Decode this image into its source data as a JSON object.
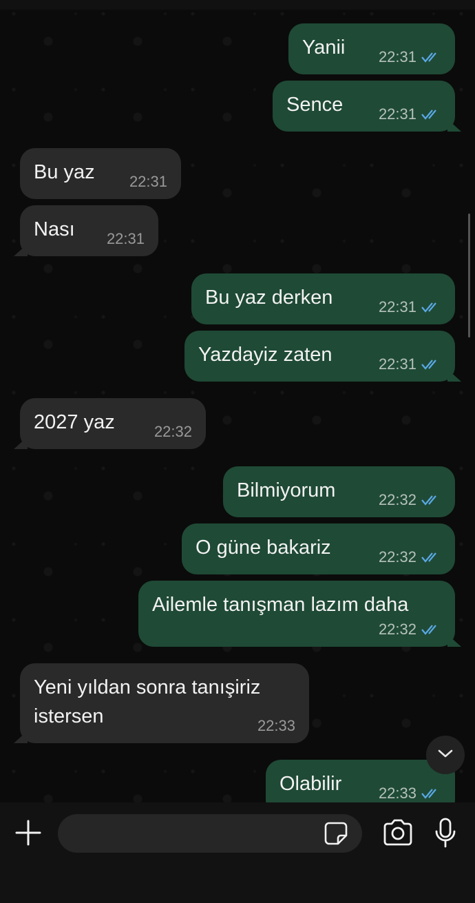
{
  "messages": [
    {
      "dir": "out",
      "text": "Yanii",
      "time": "22:31"
    },
    {
      "dir": "out",
      "text": "Sence",
      "time": "22:31"
    },
    {
      "dir": "in",
      "text": "Bu yaz",
      "time": "22:31"
    },
    {
      "dir": "in",
      "text": "Nası",
      "time": "22:31"
    },
    {
      "dir": "out",
      "text": "Bu yaz derken",
      "time": "22:31"
    },
    {
      "dir": "out",
      "text": "Yazdayiz zaten",
      "time": "22:31"
    },
    {
      "dir": "in",
      "text": "2027 yaz",
      "time": "22:32"
    },
    {
      "dir": "out",
      "text": "Bilmiyorum",
      "time": "22:32"
    },
    {
      "dir": "out",
      "text": "O güne bakariz",
      "time": "22:32"
    },
    {
      "dir": "out",
      "text": "Ailemle tanışman lazım daha",
      "time": "22:32"
    },
    {
      "dir": "in",
      "text": "Yeni yıldan sonra tanışiriz",
      "text2": "istersen",
      "time": "22:33"
    },
    {
      "dir": "out",
      "text": "Olabilir",
      "time": "22:33"
    }
  ],
  "input": {
    "placeholder": ""
  },
  "icons": [
    "plus-icon",
    "sticker-icon",
    "camera-icon",
    "mic-icon",
    "chevron-down-icon",
    "double-check-icon"
  ],
  "colors": {
    "outgoing_bubble": "#1f4a36",
    "incoming_bubble": "#2a2a2a",
    "read_ticks": "#5aa9e6"
  }
}
